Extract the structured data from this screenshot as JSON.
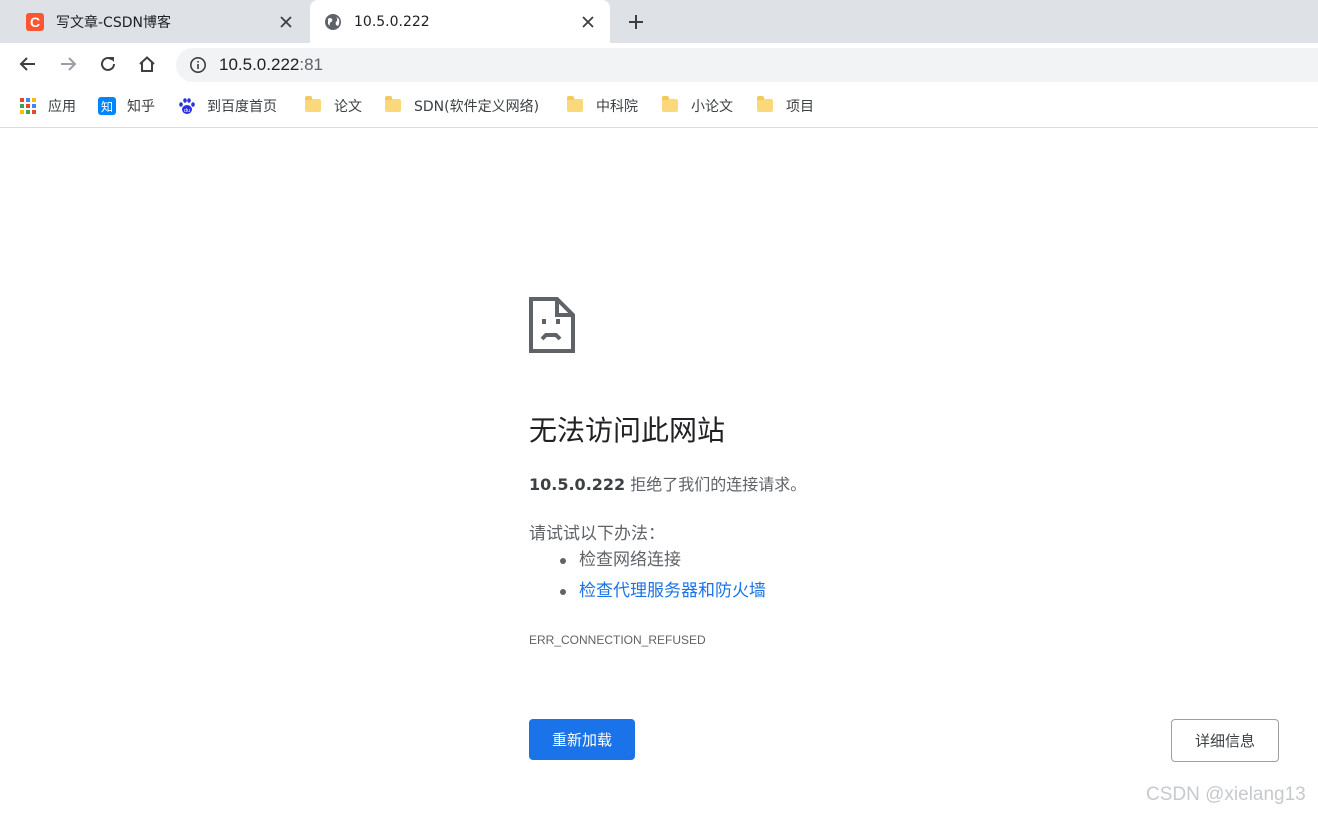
{
  "tabs": [
    {
      "title": "写文章-CSDN博客",
      "favicon": "csdn-logo",
      "favicon_text": "C",
      "active": false
    },
    {
      "title": "10.5.0.222",
      "favicon": "globe-icon",
      "active": true
    }
  ],
  "toolbar": {
    "url_host": "10.5.0.222",
    "url_port": ":81"
  },
  "bookmarks": [
    {
      "label": "应用",
      "icon": "apps-grid-icon"
    },
    {
      "label": "知乎",
      "icon": "zhihu-icon",
      "icon_text": "知"
    },
    {
      "label": "到百度首页",
      "icon": "baidu-paw-icon"
    },
    {
      "label": "论文",
      "icon": "folder-icon"
    },
    {
      "label": "SDN(软件定义网络)",
      "icon": "folder-icon"
    },
    {
      "label": "中科院",
      "icon": "folder-icon"
    },
    {
      "label": "小论文",
      "icon": "folder-icon"
    },
    {
      "label": "项目",
      "icon": "folder-icon"
    }
  ],
  "error": {
    "icon": "sad-document-icon",
    "heading": "无法访问此网站",
    "host": "10.5.0.222",
    "message": "拒绝了我们的连接请求。",
    "suggest_title": "请试试以下办法：",
    "suggestions": [
      "检查网络连接",
      "检查代理服务器和防火墙"
    ],
    "code": "ERR_CONNECTION_REFUSED",
    "reload_label": "重新加载",
    "details_label": "详细信息"
  },
  "watermark": "CSDN @xielang13",
  "colors": {
    "accent": "#1a73e8",
    "tabstrip": "#dee1e6",
    "csdn_brand": "#fc5531"
  }
}
